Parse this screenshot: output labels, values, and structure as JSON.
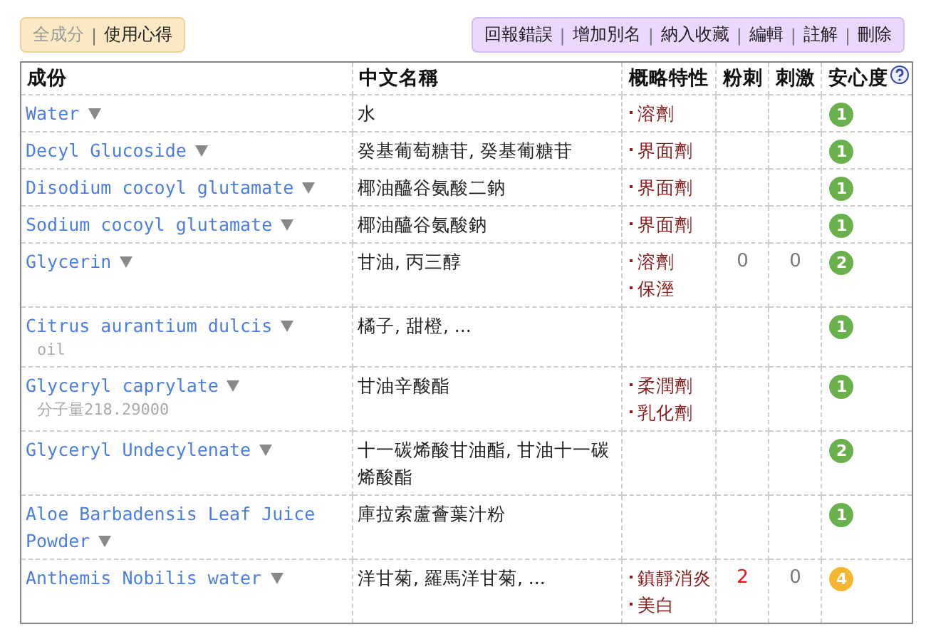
{
  "view_tabs": [
    {
      "label": "全成分",
      "selected": true
    },
    {
      "label": "使用心得",
      "selected": false
    }
  ],
  "view_separators": [
    "|"
  ],
  "actions": [
    "回報錯誤",
    "增加別名",
    "納入收藏",
    "編輯",
    "註解",
    "刪除"
  ],
  "action_separators": [
    "|",
    "|",
    "|",
    "|",
    "|"
  ],
  "table": {
    "columns": [
      "成份",
      "中文名稱",
      "概略特性",
      "粉刺",
      "刺激",
      "安心度"
    ],
    "rows": [
      {
        "name": "Water",
        "chinese": "水",
        "properties": [
          "溶劑"
        ],
        "safety": {
          "value": "1",
          "color": "#6ab04c"
        }
      },
      {
        "name": "Decyl Glucoside",
        "chinese": "癸基葡萄糖苷, 癸基葡糖苷",
        "properties": [
          "界面劑"
        ],
        "safety": {
          "value": "1",
          "color": "#6ab04c"
        }
      },
      {
        "name": "Disodium cocoyl glutamate",
        "chinese": "椰油醯谷氨酸二鈉",
        "properties": [
          "界面劑"
        ],
        "safety": {
          "value": "1",
          "color": "#6ab04c"
        }
      },
      {
        "name": "Sodium cocoyl glutamate",
        "chinese": "椰油醯谷氨酸鈉",
        "properties": [
          "界面劑"
        ],
        "safety": {
          "value": "1",
          "color": "#6ab04c"
        }
      },
      {
        "name": "Glycerin",
        "chinese": "甘油, 丙三醇",
        "properties": [
          "溶劑",
          "保溼"
        ],
        "acne": {
          "text": "0",
          "color": "#777777"
        },
        "irritation": {
          "text": "0",
          "color": "#777777"
        },
        "safety": {
          "value": "2",
          "color": "#6ab04c"
        }
      },
      {
        "name": "Citrus aurantium dulcis",
        "note": "oil",
        "chinese": "橘子, 甜橙, ...",
        "properties": [],
        "safety": {
          "value": "1",
          "color": "#6ab04c"
        }
      },
      {
        "name": "Glyceryl caprylate",
        "note": "分子量218.29000",
        "chinese": "甘油辛酸酯",
        "properties": [
          "柔潤劑",
          "乳化劑"
        ],
        "safety": {
          "value": "1",
          "color": "#6ab04c"
        }
      },
      {
        "name": "Glyceryl Undecylenate",
        "chinese": "十一碳烯酸甘油酯, 甘油十一碳烯酸酯",
        "properties": [],
        "safety": {
          "value": "2",
          "color": "#6ab04c"
        }
      },
      {
        "name": "Aloe Barbadensis Leaf Juice Powder",
        "chinese": "庫拉索蘆薈葉汁粉",
        "properties": [],
        "safety": {
          "value": "1",
          "color": "#6ab04c"
        }
      },
      {
        "name": "Anthemis Nobilis water",
        "chinese": "洋甘菊, 羅馬洋甘菊, ...",
        "properties": [
          "鎮靜消炎",
          "美白"
        ],
        "acne": {
          "text": "2",
          "color": "#e8141b"
        },
        "irritation": {
          "text": "0",
          "color": "#777777"
        },
        "safety": {
          "value": "4",
          "color": "#f5b731"
        }
      }
    ]
  }
}
